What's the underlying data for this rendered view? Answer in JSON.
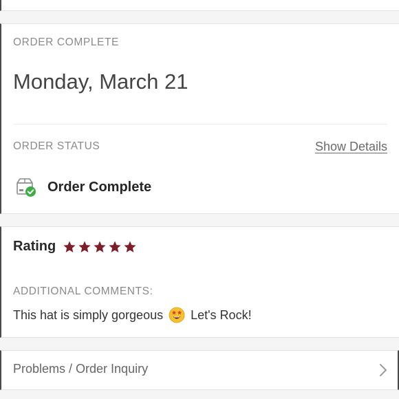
{
  "order": {
    "eyebrow": "ORDER COMPLETE",
    "date": "Monday, March 21",
    "status_label": "ORDER STATUS",
    "show_details": "Show Details",
    "status_text": "Order Complete",
    "status_icon": "package-delivered-icon"
  },
  "rating": {
    "label": "Rating",
    "stars": 5,
    "star_color": "#7d1f2a",
    "comments_label": "ADDITIONAL COMMENTS:",
    "comment_text_before": "This hat is simply gorgeous",
    "comment_emoji": "star-struck-emoji",
    "comment_text_after": "Let's Rock!"
  },
  "inquiry": {
    "label": "Problems / Order Inquiry",
    "icon": "chevron-right-icon"
  },
  "colors": {
    "accent_success": "#3fae49",
    "star": "#7d1f2a"
  }
}
